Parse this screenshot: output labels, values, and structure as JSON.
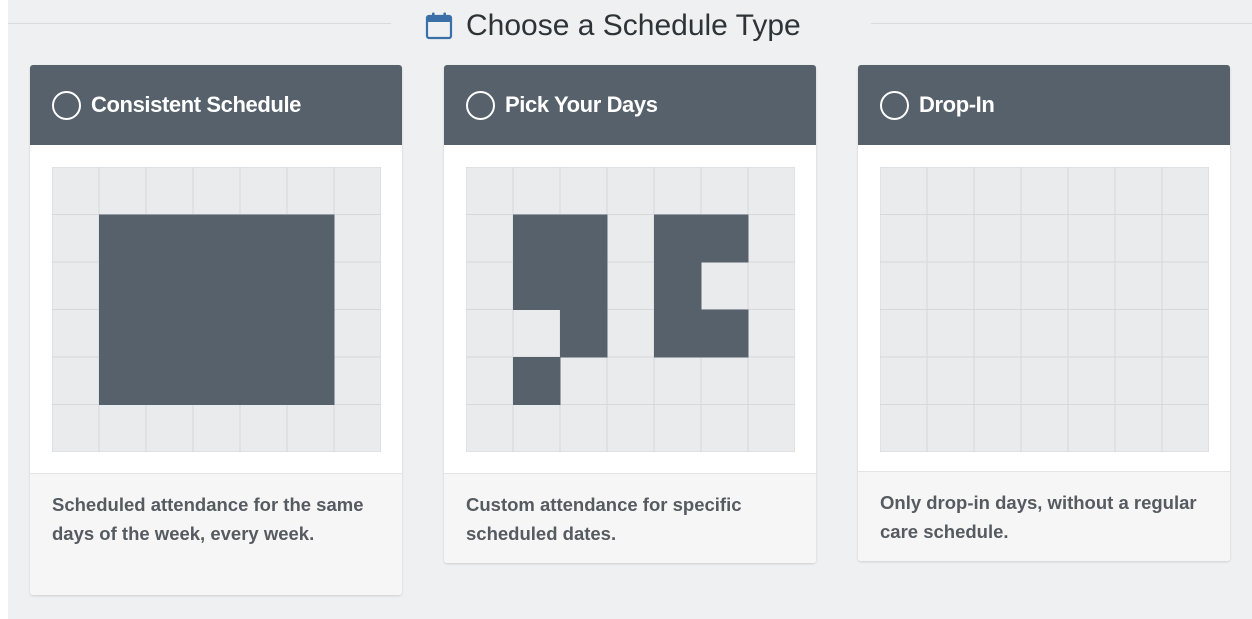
{
  "heading": {
    "title": "Choose a Schedule Type",
    "icon": "calendar-icon"
  },
  "colors": {
    "header_bg": "#56616b",
    "grid_bg": "#e9ebec",
    "grid_line": "#d5d9dc",
    "filled_cell": "#56616b",
    "page_bg": "#eff0f1"
  },
  "grid": {
    "columns": 7,
    "rows": 6
  },
  "cards": [
    {
      "title": "Consistent Schedule",
      "selected": false,
      "description": "Scheduled attendance for the same days of the week, every week.",
      "filled_cells": [
        [
          1,
          1
        ],
        [
          1,
          2
        ],
        [
          1,
          3
        ],
        [
          1,
          4
        ],
        [
          1,
          5
        ],
        [
          2,
          1
        ],
        [
          2,
          2
        ],
        [
          2,
          3
        ],
        [
          2,
          4
        ],
        [
          2,
          5
        ],
        [
          3,
          1
        ],
        [
          3,
          2
        ],
        [
          3,
          3
        ],
        [
          3,
          4
        ],
        [
          3,
          5
        ],
        [
          4,
          1
        ],
        [
          4,
          2
        ],
        [
          4,
          3
        ],
        [
          4,
          4
        ],
        [
          4,
          5
        ]
      ]
    },
    {
      "title": "Pick Your Days",
      "selected": false,
      "description": "Custom attendance for specific scheduled dates.",
      "filled_cells": [
        [
          1,
          1
        ],
        [
          1,
          2
        ],
        [
          1,
          4
        ],
        [
          1,
          5
        ],
        [
          2,
          1
        ],
        [
          2,
          2
        ],
        [
          2,
          4
        ],
        [
          3,
          2
        ],
        [
          3,
          4
        ],
        [
          3,
          5
        ],
        [
          4,
          1
        ]
      ]
    },
    {
      "title": "Drop-In",
      "selected": false,
      "description": "Only drop-in days, without a regular care schedule.",
      "filled_cells": []
    }
  ]
}
